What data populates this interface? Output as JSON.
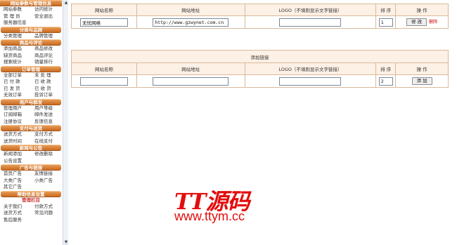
{
  "sidebar": {
    "sections": [
      {
        "title": "网站参数与管理信息",
        "first": true,
        "items": [
          "网站参数",
          "访问统计",
          "管 理 员",
          "安全退出",
          "服务器信息"
        ]
      },
      {
        "title": "分类与品牌",
        "items": [
          "分类管理",
          "品牌管理"
        ]
      },
      {
        "title": "商品与评论",
        "items": [
          "添加商品",
          "商品修改",
          "缺货商品",
          "商品评论",
          "搜索统计",
          "销量排行"
        ]
      },
      {
        "title": "订单管理",
        "items": [
          "全部订单",
          "未 处 理",
          "已 付 款",
          "已 收 款",
          "已 发 货",
          "已 收 货",
          "无效订单",
          "投诉订单"
        ]
      },
      {
        "title": "用户与群发",
        "items": [
          "管理用户",
          "用户等级",
          "订阅邮箱",
          "邮件发送",
          "注册协议",
          "反馈信息"
        ]
      },
      {
        "title": "支付与送货",
        "items": [
          "送货方式",
          "支付方式",
          "送货时间",
          "在线支付"
        ]
      },
      {
        "title": "新闻与公告",
        "items": [
          "新闻添加",
          "修改删除",
          "公告设置"
        ]
      },
      {
        "title": "广告与链接",
        "items": [
          "首页广告",
          "友情链接",
          "大类广告",
          "小类广告",
          "其它广告"
        ]
      },
      {
        "title": "帮助信息设置",
        "items": []
      },
      {
        "title": "管理栏目",
        "sub": true,
        "items": [
          "关于我们",
          "付款方式",
          "送货方式",
          "常见问题",
          "售后服务"
        ]
      }
    ]
  },
  "links_table": {
    "headers": {
      "name": "网站名称",
      "url": "网站地址",
      "logo": "LOGO（不填则显示文字链接）",
      "sort": "排 序",
      "op": "操 作"
    },
    "row": {
      "name": "无忧网络",
      "url": "http://www.gzwynet.com.cn",
      "logo": "",
      "sort": "1",
      "edit_label": "修 改",
      "delete_label": "删除"
    }
  },
  "add_table": {
    "title": "添加链接",
    "headers": {
      "name": "网站名称",
      "url": "网站地址",
      "logo": "LOGO（不填则显示文字链接）",
      "sort": "排 序",
      "op": "操 作"
    },
    "row": {
      "name": "",
      "url": "",
      "logo": "",
      "sort": "2",
      "add_label": "添 加"
    }
  },
  "watermark": {
    "title": "TT源码",
    "url": "www.ttym.cc"
  },
  "colors": {
    "section_header": "#d47a33",
    "table_border": "#d9b99b",
    "header_bg": "#fdf0e5",
    "delete_link": "#cc0000",
    "watermark": "#e30d0d"
  }
}
